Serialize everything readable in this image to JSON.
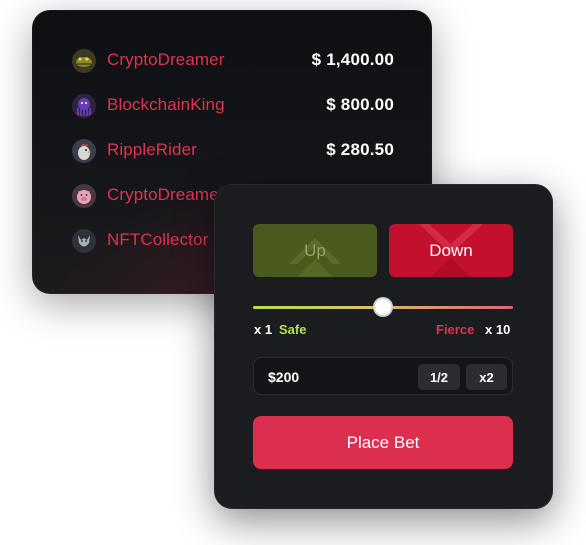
{
  "leaderboard": {
    "rows": [
      {
        "name": "CryptoDreamer",
        "amount": "$ 1,400.00",
        "avatar_icon": "crocodile-avatar-icon"
      },
      {
        "name": "BlockchainKing",
        "amount": "$ 800.00",
        "avatar_icon": "octopus-avatar-icon"
      },
      {
        "name": "RippleRider",
        "amount": "$ 280.50",
        "avatar_icon": "rooster-avatar-icon"
      },
      {
        "name": "CryptoDreamer",
        "amount": "",
        "avatar_icon": "pig-avatar-icon"
      },
      {
        "name": "NFTCollector",
        "amount": "",
        "avatar_icon": "wolf-avatar-icon"
      }
    ]
  },
  "bet": {
    "up_label": "Up",
    "down_label": "Down",
    "risk_level": 0.5,
    "min_multiplier": "x 1",
    "safe_label": "Safe",
    "fierce_label": "Fierce",
    "max_multiplier": "x 10",
    "amount_value": "$200",
    "half_label": "1/2",
    "double_label": "x2",
    "place_bet_label": "Place Bet"
  },
  "colors": {
    "accent_red": "#dc2f4f",
    "username_red": "#e0334f",
    "safe_green": "#b4e04a",
    "panel_bg": "#1b1c20"
  }
}
